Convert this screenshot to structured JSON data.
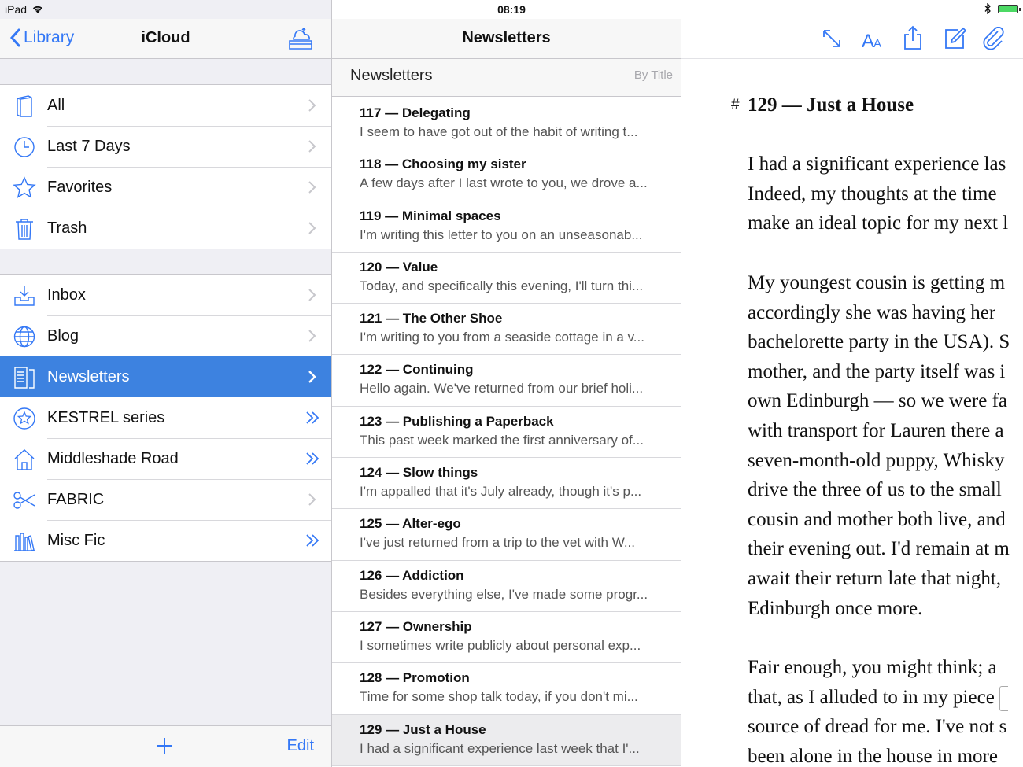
{
  "status": {
    "device": "iPad",
    "time": "08:19",
    "battery_level": 1.0
  },
  "sidebar": {
    "back_label": "Library",
    "title": "iCloud",
    "groups": [
      {
        "items": [
          {
            "label": "All",
            "icon": "book-icon",
            "chevron": "single"
          },
          {
            "label": "Last 7 Days",
            "icon": "clock-icon",
            "chevron": "single"
          },
          {
            "label": "Favorites",
            "icon": "star-icon",
            "chevron": "single"
          },
          {
            "label": "Trash",
            "icon": "trash-icon",
            "chevron": "single"
          }
        ]
      },
      {
        "items": [
          {
            "label": "Inbox",
            "icon": "inbox-icon",
            "chevron": "single"
          },
          {
            "label": "Blog",
            "icon": "globe-icon",
            "chevron": "single"
          },
          {
            "label": "Newsletters",
            "icon": "document-icon",
            "chevron": "single",
            "selected": true
          },
          {
            "label": "KESTREL series",
            "icon": "star-circle-icon",
            "chevron": "double"
          },
          {
            "label": "Middleshade Road",
            "icon": "house-icon",
            "chevron": "double"
          },
          {
            "label": "FABRIC",
            "icon": "scissors-icon",
            "chevron": "single"
          },
          {
            "label": "Misc Fic",
            "icon": "books-icon",
            "chevron": "double"
          }
        ]
      }
    ],
    "edit_label": "Edit"
  },
  "list": {
    "title": "Newsletters",
    "section_title": "Newsletters",
    "sort_label": "By Title",
    "items": [
      {
        "title": "117 — Delegating",
        "excerpt": "I seem to have got out of the habit of writing t..."
      },
      {
        "title": "118 — Choosing my sister",
        "excerpt": "A few days after I last wrote to you, we drove a..."
      },
      {
        "title": "119 — Minimal spaces",
        "excerpt": "I'm writing this letter to you on an unseasonab..."
      },
      {
        "title": "120 — Value",
        "excerpt": "Today, and specifically this evening, I'll turn thi..."
      },
      {
        "title": "121 — The Other Shoe",
        "excerpt": "I'm writing to you from a seaside cottage in a v..."
      },
      {
        "title": "122 — Continuing",
        "excerpt": "Hello again. We've returned from our brief holi..."
      },
      {
        "title": "123 — Publishing a Paperback",
        "excerpt": "This past week marked the first anniversary of..."
      },
      {
        "title": "124 — Slow things",
        "excerpt": "I'm appalled that it's July already, though it's p..."
      },
      {
        "title": "125 — Alter-ego",
        "excerpt": "I've just returned from a trip to the vet with W..."
      },
      {
        "title": "126 — Addiction",
        "excerpt": "Besides everything else, I've made some progr..."
      },
      {
        "title": "127 — Ownership",
        "excerpt": "I sometimes write publicly about personal exp..."
      },
      {
        "title": "128 — Promotion",
        "excerpt": "Time for some shop talk today, if you don't mi..."
      },
      {
        "title": "129 — Just a House",
        "excerpt": "I had a significant experience last week that I'...",
        "selected": true
      }
    ]
  },
  "editor": {
    "hash": "#",
    "heading": "129 — Just a House",
    "paragraphs": [
      [
        "I had a significant experience las",
        "Indeed, my thoughts at the time",
        "make an ideal topic for my next l"
      ],
      [
        "My youngest cousin is getting m",
        "accordingly she was having her",
        "bachelorette party in the USA). S",
        "mother, and the party itself was i",
        "own Edinburgh — so we were fa",
        "with transport for Lauren there a",
        "seven-month-old puppy, Whisky",
        "drive the three of us to the small",
        "cousin and mother both live, and",
        "their evening out. I'd remain at m",
        "await their return late that night,",
        "Edinburgh once more."
      ],
      [
        "Fair enough, you might think; a",
        "that, as I alluded to in my piece",
        "source of dread for me. I've not s",
        "been alone in the house in more"
      ]
    ]
  },
  "colors": {
    "accent": "#3478f6",
    "selected_row": "#3d82e0"
  }
}
